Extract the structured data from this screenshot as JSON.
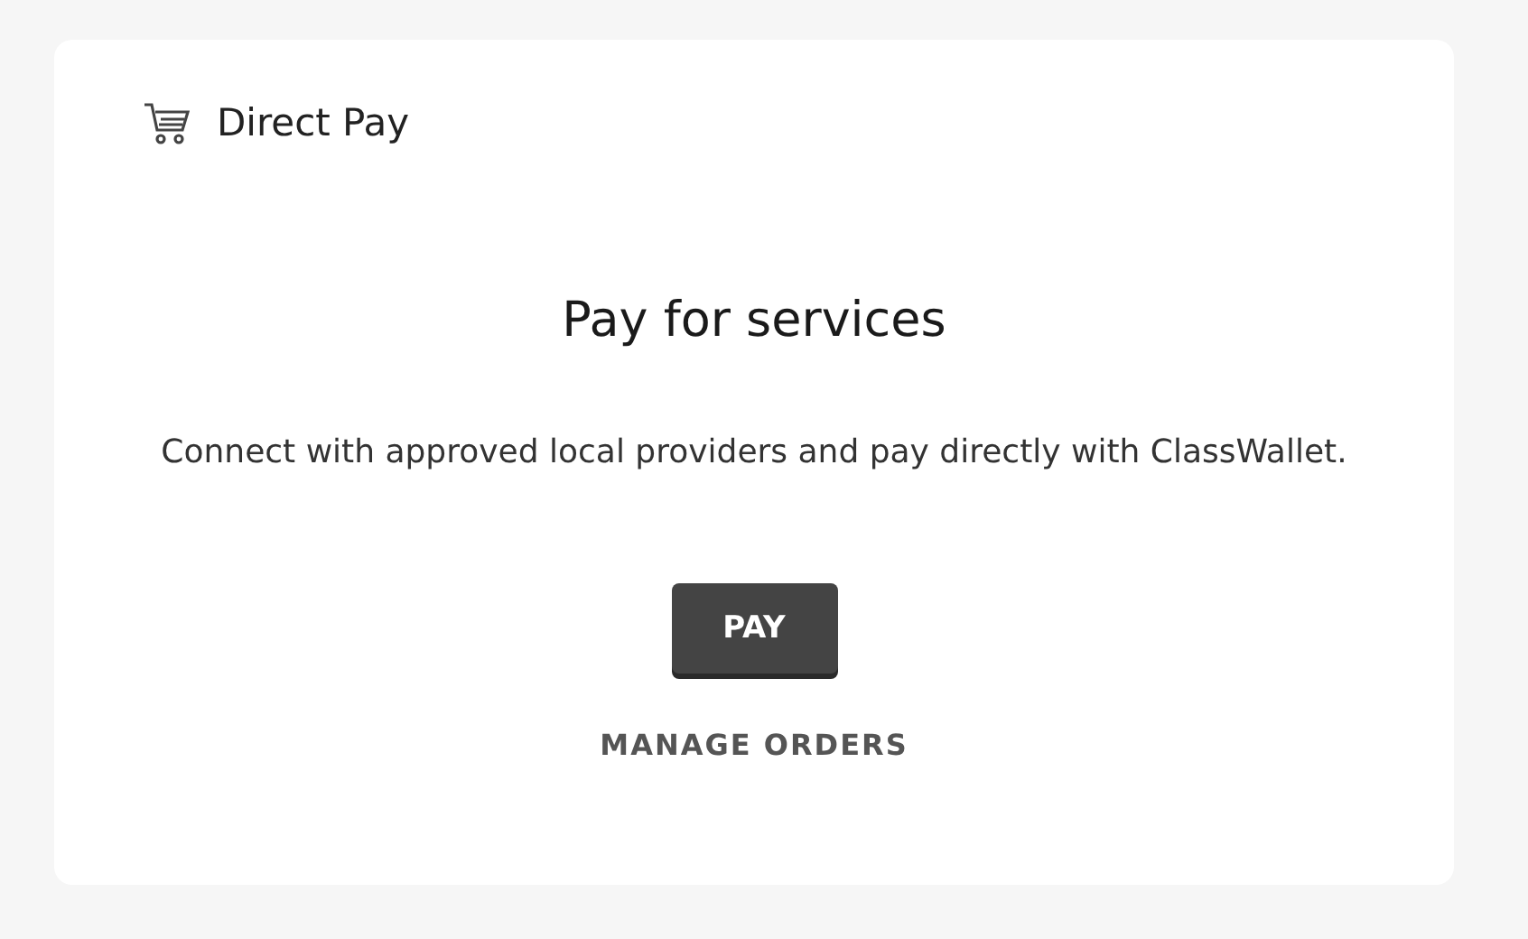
{
  "header": {
    "title": "Direct Pay"
  },
  "title": "Pay for services",
  "description": "Connect with approved local providers and pay directly with ClassWallet.",
  "buttons": [
    {
      "label": "PAY",
      "kind": "primary"
    },
    {
      "label": "MANAGE ORDERS",
      "kind": "link"
    }
  ]
}
